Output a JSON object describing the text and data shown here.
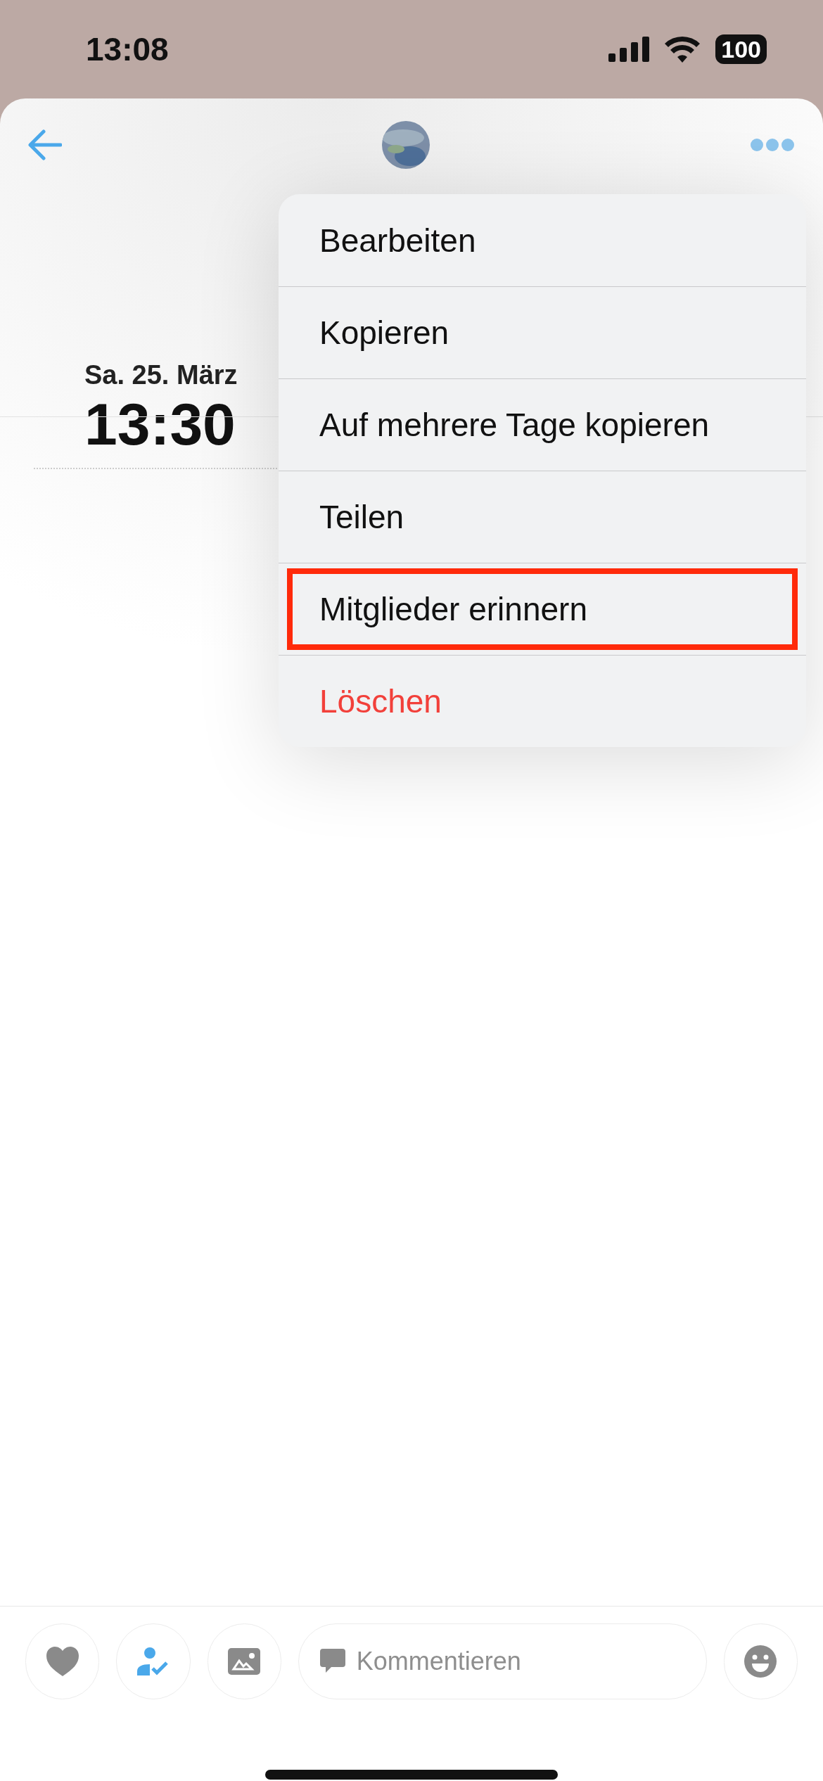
{
  "status_bar": {
    "time": "13:08",
    "battery": "100"
  },
  "event": {
    "date": "Sa. 25. März",
    "time": "13:30"
  },
  "menu": {
    "items": [
      {
        "label": "Bearbeiten",
        "kind": "normal",
        "highlighted": false
      },
      {
        "label": "Kopieren",
        "kind": "normal",
        "highlighted": false
      },
      {
        "label": "Auf mehrere Tage kopieren",
        "kind": "normal",
        "highlighted": false
      },
      {
        "label": "Teilen",
        "kind": "normal",
        "highlighted": false
      },
      {
        "label": "Mitglieder erinnern",
        "kind": "normal",
        "highlighted": true
      },
      {
        "label": "Löschen",
        "kind": "destructive",
        "highlighted": false
      }
    ]
  },
  "comment": {
    "placeholder": "Kommentieren"
  }
}
